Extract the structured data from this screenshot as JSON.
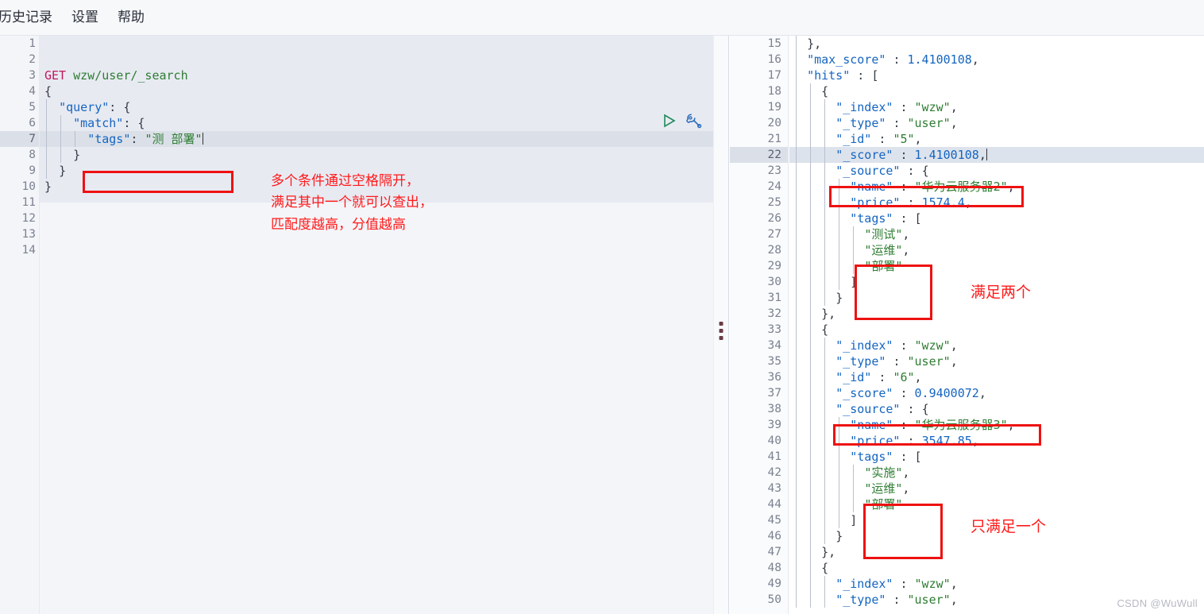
{
  "menu": {
    "items": [
      {
        "label": "历史记录",
        "name": "menu-history"
      },
      {
        "label": "设置",
        "name": "menu-settings"
      },
      {
        "label": "帮助",
        "name": "menu-help"
      }
    ]
  },
  "colors": {
    "annotation_red": "#ff1a1a",
    "box_red": "#ee1111",
    "editor_bg": "#e8eaf2",
    "highlight_line": "#dbe0e8",
    "response_bg": "#ffffff"
  },
  "editor": {
    "icons": [
      {
        "name": "run-request-icon",
        "glyph": "▷",
        "color": "#1f8a5a"
      },
      {
        "name": "wrench-icon",
        "glyph": "🔧",
        "color": "#2a6ebb"
      }
    ],
    "highlighted_line": 7,
    "cursor_line": 7,
    "first_line": 1,
    "last_line": 14,
    "lines": [
      {
        "n": 1,
        "fold": "",
        "text": ""
      },
      {
        "n": 2,
        "fold": "",
        "text": ""
      },
      {
        "n": 3,
        "fold": "",
        "text": "GET wzw/user/_search"
      },
      {
        "n": 4,
        "fold": "▾",
        "text": "{"
      },
      {
        "n": 5,
        "fold": "▾",
        "text": "  \"query\": {"
      },
      {
        "n": 6,
        "fold": "▾",
        "text": "    \"match\": {"
      },
      {
        "n": 7,
        "fold": "",
        "text": "      \"tags\": \"测 部署\""
      },
      {
        "n": 8,
        "fold": "▴",
        "text": "    }"
      },
      {
        "n": 9,
        "fold": "▴",
        "text": "  }"
      },
      {
        "n": 10,
        "fold": "▴",
        "text": "}"
      },
      {
        "n": 11,
        "fold": "",
        "text": ""
      },
      {
        "n": 12,
        "fold": "",
        "text": ""
      },
      {
        "n": 13,
        "fold": "",
        "text": ""
      },
      {
        "n": 14,
        "fold": "",
        "text": ""
      }
    ],
    "annotation": {
      "name": "query-annotation",
      "line1": "多个条件通过空格隔开，",
      "line2": "满足其中一个就可以查出，",
      "line3": "匹配度越高，分值越高"
    },
    "request": {
      "method": "GET",
      "path": "wzw/user/_search",
      "match_field": "tags",
      "match_value": "测 部署"
    }
  },
  "response": {
    "highlighted_line": 22,
    "first_line": 15,
    "last_line": 50,
    "lines": [
      {
        "n": 15,
        "fold": "▴",
        "text": "  },"
      },
      {
        "n": 16,
        "fold": "",
        "text": "  \"max_score\" : 1.4100108,"
      },
      {
        "n": 17,
        "fold": "▾",
        "text": "  \"hits\" : ["
      },
      {
        "n": 18,
        "fold": "▾",
        "text": "    {"
      },
      {
        "n": 19,
        "fold": "",
        "text": "      \"_index\" : \"wzw\","
      },
      {
        "n": 20,
        "fold": "",
        "text": "      \"_type\" : \"user\","
      },
      {
        "n": 21,
        "fold": "",
        "text": "      \"_id\" : \"5\","
      },
      {
        "n": 22,
        "fold": "",
        "text": "      \"_score\" : 1.4100108,"
      },
      {
        "n": 23,
        "fold": "▾",
        "text": "      \"_source\" : {"
      },
      {
        "n": 24,
        "fold": "",
        "text": "        \"name\" : \"华为云服务器2\","
      },
      {
        "n": 25,
        "fold": "",
        "text": "        \"price\" : 1574.4,"
      },
      {
        "n": 26,
        "fold": "▾",
        "text": "        \"tags\" : ["
      },
      {
        "n": 27,
        "fold": "",
        "text": "          \"测试\","
      },
      {
        "n": 28,
        "fold": "",
        "text": "          \"运维\","
      },
      {
        "n": 29,
        "fold": "",
        "text": "          \"部署\""
      },
      {
        "n": 30,
        "fold": "▴",
        "text": "        ]"
      },
      {
        "n": 31,
        "fold": "▴",
        "text": "      }"
      },
      {
        "n": 32,
        "fold": "▴",
        "text": "    },"
      },
      {
        "n": 33,
        "fold": "▾",
        "text": "    {"
      },
      {
        "n": 34,
        "fold": "",
        "text": "      \"_index\" : \"wzw\","
      },
      {
        "n": 35,
        "fold": "",
        "text": "      \"_type\" : \"user\","
      },
      {
        "n": 36,
        "fold": "",
        "text": "      \"_id\" : \"6\","
      },
      {
        "n": 37,
        "fold": "",
        "text": "      \"_score\" : 0.9400072,"
      },
      {
        "n": 38,
        "fold": "▾",
        "text": "      \"_source\" : {"
      },
      {
        "n": 39,
        "fold": "",
        "text": "        \"name\" : \"华为云服务器3\","
      },
      {
        "n": 40,
        "fold": "",
        "text": "        \"price\" : 3547.85,"
      },
      {
        "n": 41,
        "fold": "▾",
        "text": "        \"tags\" : ["
      },
      {
        "n": 42,
        "fold": "",
        "text": "          \"实施\","
      },
      {
        "n": 43,
        "fold": "",
        "text": "          \"运维\","
      },
      {
        "n": 44,
        "fold": "",
        "text": "          \"部署\""
      },
      {
        "n": 45,
        "fold": "▴",
        "text": "        ]"
      },
      {
        "n": 46,
        "fold": "▴",
        "text": "      }"
      },
      {
        "n": 47,
        "fold": "▴",
        "text": "    },"
      },
      {
        "n": 48,
        "fold": "▾",
        "text": "    {"
      },
      {
        "n": 49,
        "fold": "",
        "text": "      \"_index\" : \"wzw\","
      },
      {
        "n": 50,
        "fold": "",
        "text": "      \"_type\" : \"user\","
      }
    ],
    "annotations": [
      {
        "name": "hit1-tags-note",
        "text": "满足两个"
      },
      {
        "name": "hit2-tags-note",
        "text": "只满足一个"
      }
    ],
    "values": {
      "max_score": "1.4100108",
      "hit1_id": "5",
      "hit1_score": "1.4100108",
      "hit1_name": "华为云服务器2",
      "hit1_price": "1574.4",
      "hit1_tags": [
        "测试",
        "运维",
        "部署"
      ],
      "hit2_id": "6",
      "hit2_score": "0.9400072",
      "hit2_name": "华为云服务器3",
      "hit2_price": "3547.85",
      "hit2_tags": [
        "实施",
        "运维",
        "部署"
      ]
    }
  },
  "watermark": {
    "text": "CSDN @WuWull"
  }
}
